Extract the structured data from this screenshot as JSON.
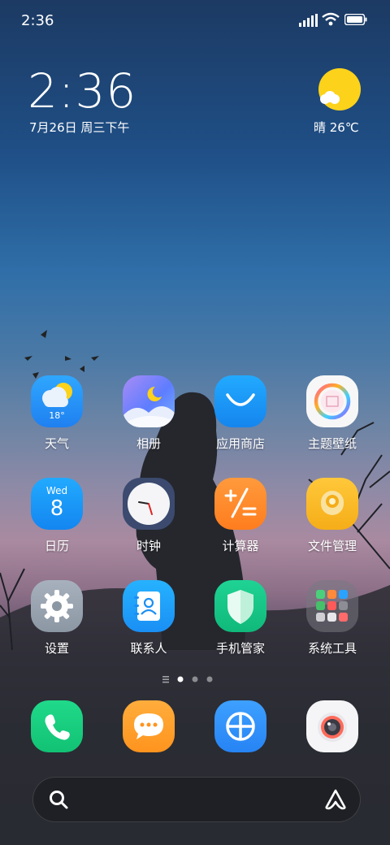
{
  "status_bar": {
    "time": "2:36"
  },
  "clock_widget": {
    "time": "2:36",
    "date": "7月26日 周三下午"
  },
  "weather_widget": {
    "condition_temp": "晴 26℃"
  },
  "apps": {
    "weather": {
      "label": "天气",
      "temp": "18°"
    },
    "gallery": {
      "label": "相册"
    },
    "app_store": {
      "label": "应用商店"
    },
    "themes": {
      "label": "主题壁纸"
    },
    "calendar": {
      "label": "日历",
      "weekday": "Wed",
      "day": "8"
    },
    "clock": {
      "label": "时钟"
    },
    "calculator": {
      "label": "计算器"
    },
    "file_manager": {
      "label": "文件管理"
    },
    "settings": {
      "label": "设置"
    },
    "contacts": {
      "label": "联系人"
    },
    "security": {
      "label": "手机管家"
    },
    "tools": {
      "label": "系统工具"
    }
  },
  "page_indicator": {
    "pages": 3,
    "current": 1
  },
  "dock": [
    "phone-icon",
    "messages-icon",
    "browser-icon",
    "camera-icon"
  ]
}
